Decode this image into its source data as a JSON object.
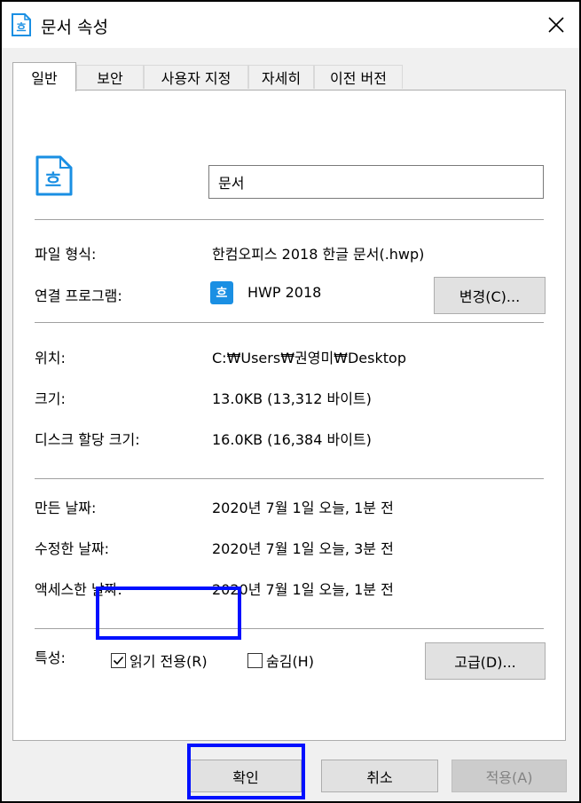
{
  "window": {
    "title": "문서 속성",
    "app_icon_glyph": "흐",
    "close_glyph": "✕"
  },
  "tabs": [
    {
      "label": "일반",
      "active": true
    },
    {
      "label": "보안",
      "active": false
    },
    {
      "label": "사용자 지정",
      "active": false
    },
    {
      "label": "자세히",
      "active": false
    },
    {
      "label": "이전 버전",
      "active": false
    }
  ],
  "general": {
    "file_name": "문서",
    "big_icon_glyph": "흐",
    "file_type_label": "파일 형식:",
    "file_type_value": "한컴오피스 2018 한글 문서(.hwp)",
    "opens_with_label": "연결 프로그램:",
    "opens_with_icon_glyph": "흐",
    "opens_with_value": "HWP 2018",
    "change_button": "변경(C)...",
    "location_label": "위치:",
    "location_value": "C:₩Users₩권영미₩Desktop",
    "size_label": "크기:",
    "size_value": "13.0KB (13,312 바이트)",
    "disk_size_label": "디스크 할당 크기:",
    "disk_size_value": "16.0KB (16,384 바이트)",
    "created_label": "만든 날짜:",
    "created_value": "2020년 7월 1일 오늘, 1분 전",
    "modified_label": "수정한 날짜:",
    "modified_value": "2020년 7월 1일 오늘, 3분 전",
    "accessed_label": "액세스한 날짜:",
    "accessed_value": "2020년 7월 1일 오늘, 1분 전",
    "attributes_label": "특성:",
    "readonly_label": "읽기 전용(R)",
    "readonly_checked": true,
    "hidden_label": "숨김(H)",
    "hidden_checked": false,
    "advanced_button": "고급(D)..."
  },
  "footer": {
    "ok_button": "확인",
    "cancel_button": "취소",
    "apply_button": "적용(A)"
  },
  "colors": {
    "highlight": "#0010ff",
    "icon_blue": "#1a8fe3"
  }
}
